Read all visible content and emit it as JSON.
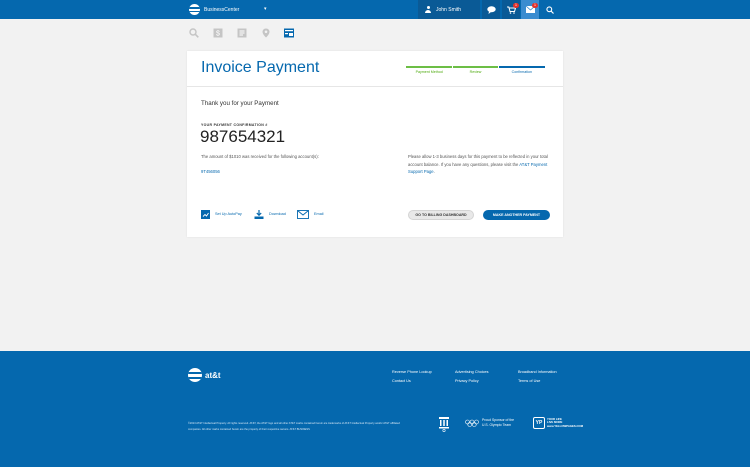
{
  "topbar": {
    "brand": "BusinessCenter",
    "brand_caret": "▾",
    "user_name": "John Smith",
    "cart_badge": "1",
    "mail_badge": "1"
  },
  "card": {
    "title": "Invoice Payment",
    "steps": [
      "Payment Method",
      "Review",
      "Confirmation"
    ],
    "thanks": "Thank you for your Payment",
    "conf_label": "YOUR PAYMENT CONFIRMATION #",
    "conf_number": "987654321",
    "amount_text": "The amount of $1010 was received for the following account(s):",
    "account": "9T456056",
    "notice_text": "Please allow 1-3 business days for this payment to be reflected in your total account balance. If you have any questions, please visit the",
    "notice_link": "AT&T Payment Support Page",
    "actions": {
      "autopay": "Set Up AutoPay",
      "download": "Download",
      "email": "Email"
    },
    "btn_dashboard": "GO TO BILLING DASHBOARD",
    "btn_another": "MAKE ANOTHER PAYMENT"
  },
  "footer": {
    "wordmark": "at&t",
    "links": {
      "reverse_phone": "Reverse Phone Lookup",
      "contact": "Contact Us",
      "advertising": "Advertising Choices",
      "privacy": "Privacy Policy",
      "broadband": "Broadband Information",
      "terms": "Terms of Use"
    },
    "legal": "©2013 AT&T Intellectual Property. All rights reserved. AT&T, the AT&T logo and all other AT&T marks contained herein are trademarks of AT&T Intellectual Property and/or AT&T affiliated companies. All other marks contained herein are the property of their respective owners. AT&T BUSINESS",
    "olympic_text_1": "Proud Sponsor of the",
    "olympic_text_2": "U.S. Olympic Team",
    "yp_box": "YP",
    "yp_text_1": "YOUR LIFE",
    "yp_text_2": "LIVE MORE",
    "yp_text_3": "www.YELLOWPAGES.COM"
  },
  "colors": {
    "brand_blue": "#0568ae",
    "progress_green": "#6cbe45",
    "badge_red": "#e4312b"
  },
  "progress": {
    "completed_steps": 3,
    "total_steps": 3
  }
}
